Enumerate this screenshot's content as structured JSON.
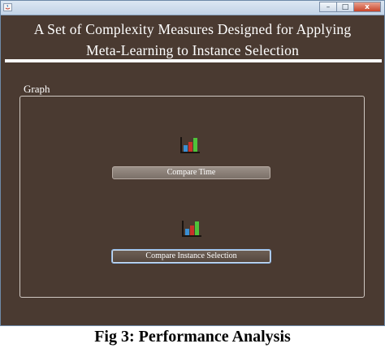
{
  "window": {
    "controls": {
      "minimize": "–",
      "maximize": "□",
      "close": "x"
    }
  },
  "header": {
    "title_line1": "A Set of Complexity Measures Designed for  Applying",
    "title_line2": "Meta-Learning to Instance Selection"
  },
  "graph": {
    "label": "Graph",
    "buttons": {
      "compare_time": "Compare Time",
      "compare_instance_selection": "Compare Instance Selection"
    },
    "icons": [
      "bar-chart-icon",
      "bar-chart-icon"
    ]
  },
  "caption": "Fig 3: Performance Analysis",
  "colors": {
    "background": "#4a3a31",
    "text": "#ffffff",
    "bar_blue": "#3a8fd4",
    "bar_red": "#c8322a",
    "bar_green": "#4fc23a"
  }
}
